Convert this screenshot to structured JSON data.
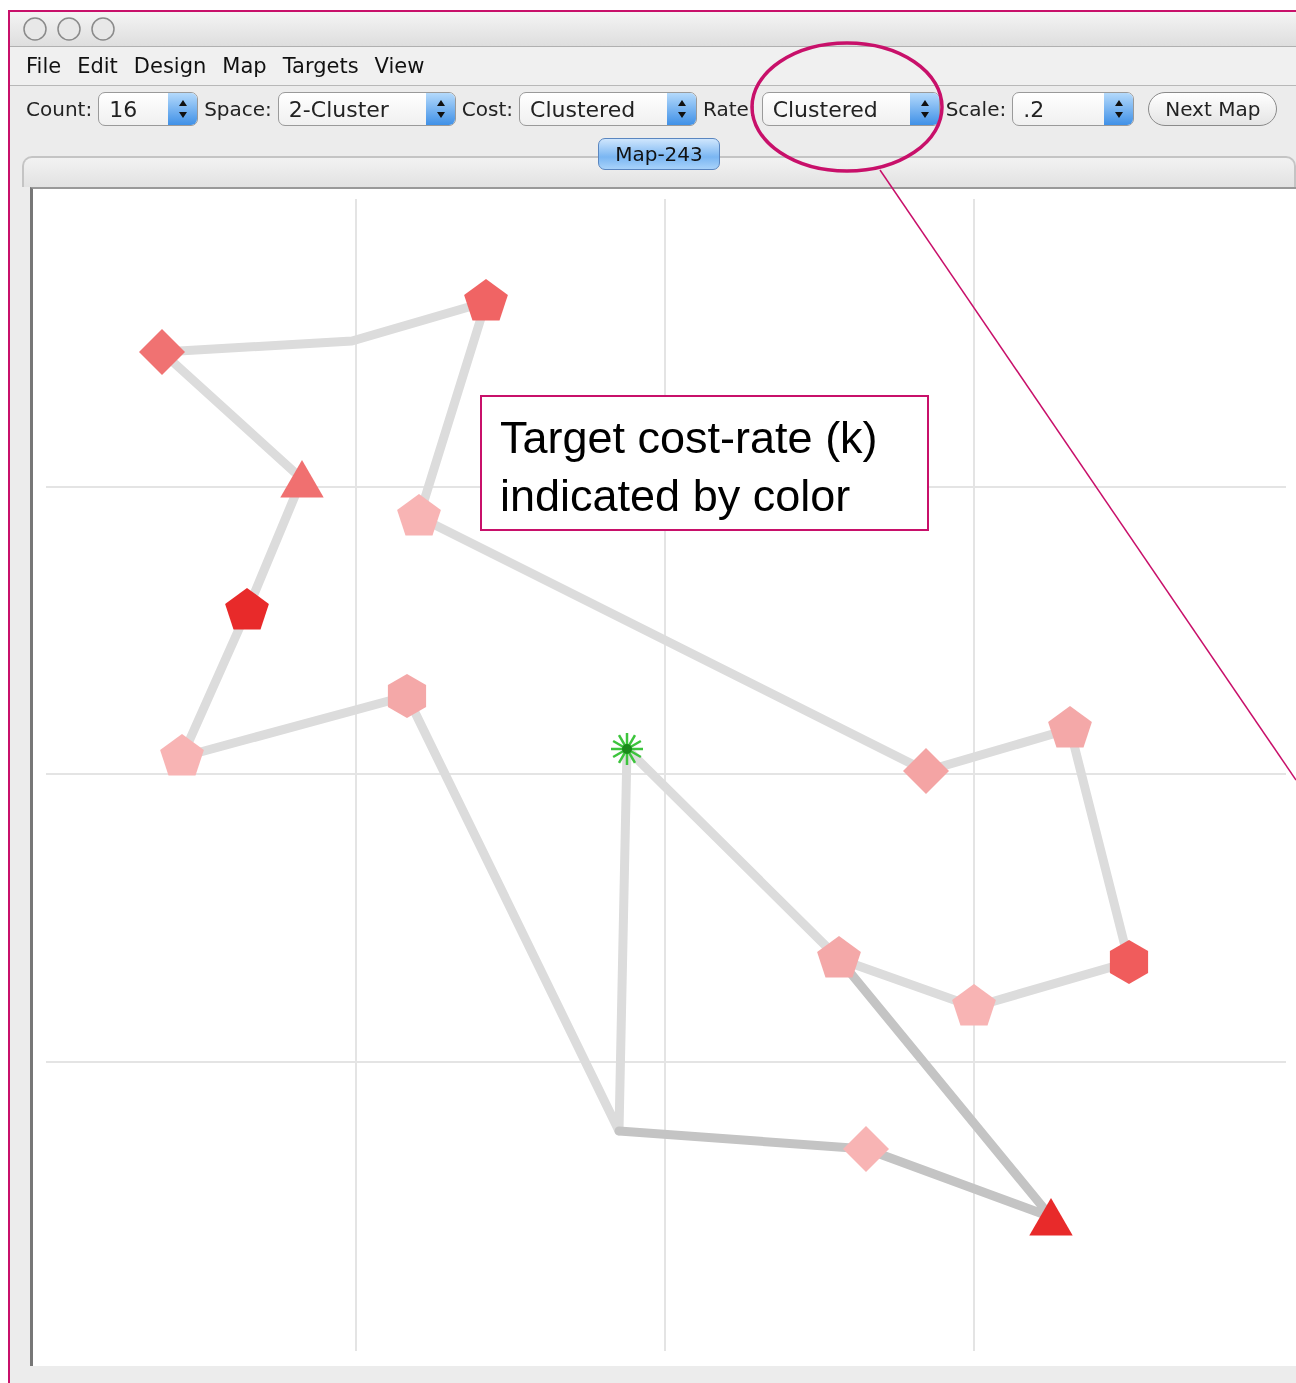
{
  "menu": [
    "File",
    "Edit",
    "Design",
    "Map",
    "Targets",
    "View"
  ],
  "toolbar": [
    {
      "label": "Count:",
      "value": "16"
    },
    {
      "label": "Space:",
      "value": "2-Cluster"
    },
    {
      "label": "Cost:",
      "value": "Clustered"
    },
    {
      "label": "Rate:",
      "value": "Clustered"
    },
    {
      "label": "Scale:",
      "value": ".2"
    }
  ],
  "next_button": "Next Map",
  "tabs": [
    {
      "label": "Map-243",
      "selected": true
    }
  ],
  "targets": [
    {
      "kind": "pentagon",
      "color": "#f06464"
    },
    {
      "kind": "diamond",
      "color": "#f07272"
    },
    {
      "kind": "triangle",
      "color": "#f07070"
    },
    {
      "kind": "pentagon",
      "color": "#f8b4b4"
    },
    {
      "kind": "pentagon",
      "color": "#e82a2a"
    },
    {
      "kind": "hexagon",
      "color": "#f4a8a8"
    },
    {
      "kind": "pentagon",
      "color": "#f8b4b4"
    },
    {
      "kind": "diamond",
      "color": "#f4a4a4"
    },
    {
      "kind": "pentagon",
      "color": "#f4a8a8"
    },
    {
      "kind": "hexagon",
      "color": "#f05c5c"
    },
    {
      "kind": "pentagon",
      "color": "#f4a8a8"
    },
    {
      "kind": "pentagon",
      "color": "#f8b4b4"
    },
    {
      "kind": "diamond",
      "color": "#f8b4b4"
    },
    {
      "kind": "triangle",
      "color": "#e82a2a"
    }
  ],
  "annotation": {
    "text": "Target cost-rate (k) indicated by color"
  }
}
